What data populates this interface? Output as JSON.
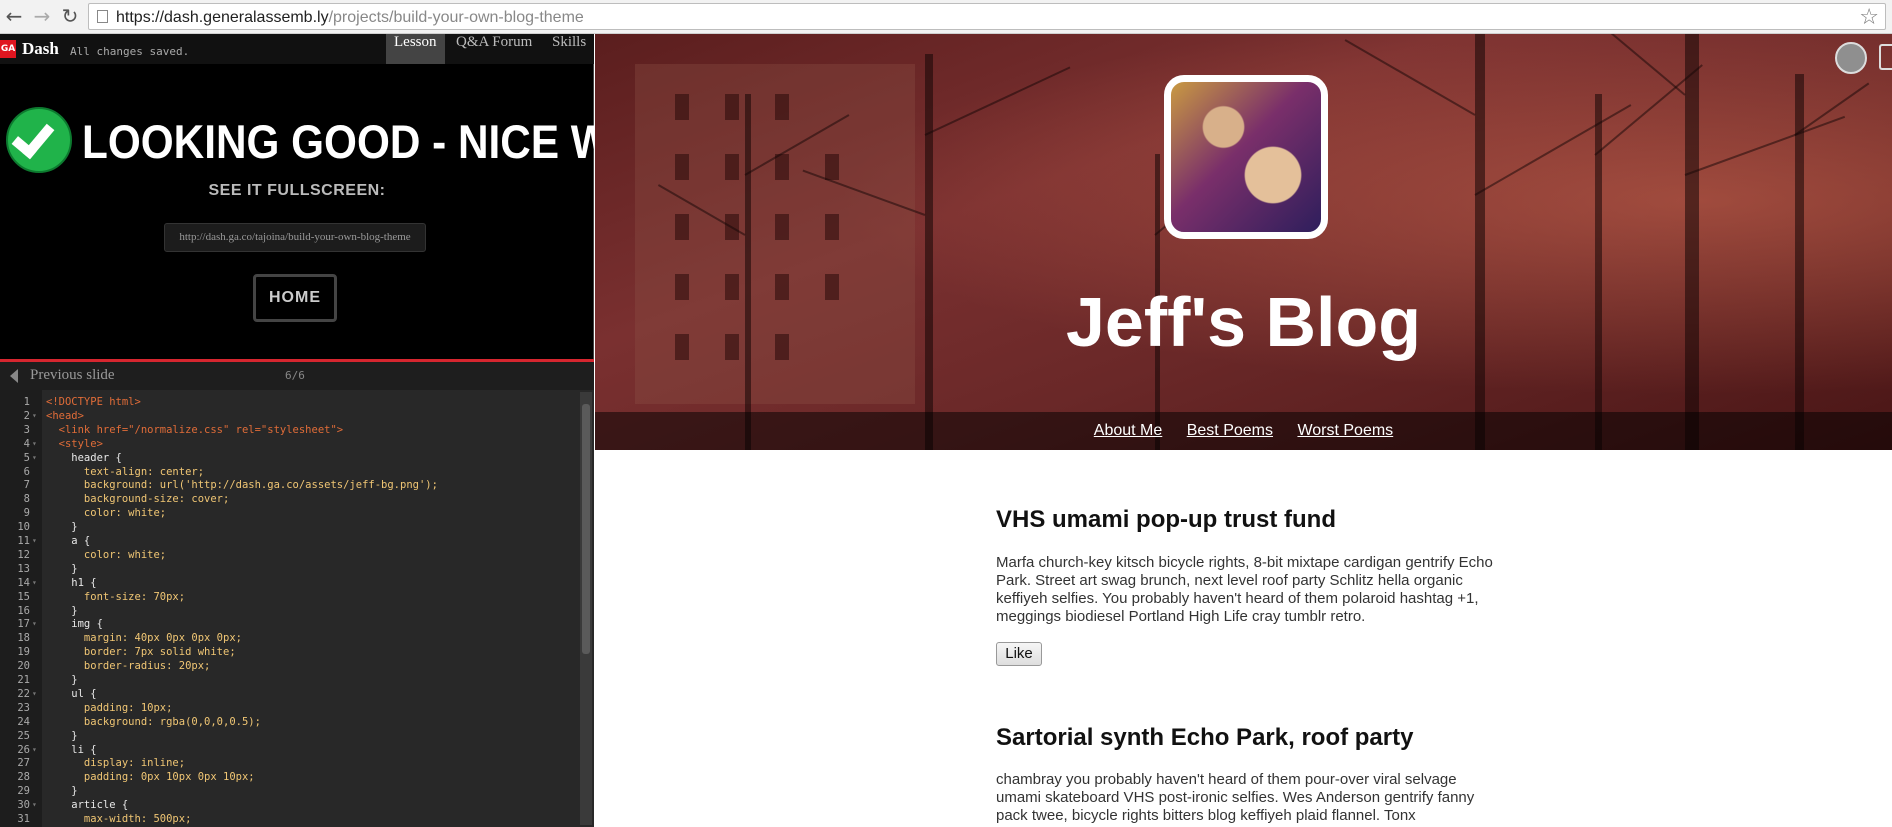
{
  "browser": {
    "url_host": "https://dash.generalassemb.ly",
    "url_path": "/projects/build-your-own-blog-theme"
  },
  "dash": {
    "logo_text": "GA",
    "app_name": "Dash",
    "status": "All changes saved.",
    "tabs": [
      {
        "label": "Lesson",
        "active": true
      },
      {
        "label": "Q&A Forum",
        "active": false
      },
      {
        "label": "Skills",
        "active": false
      }
    ],
    "success_title": "LOOKING GOOD - NICE WORK!",
    "fullscreen_label": "SEE IT FULLSCREEN:",
    "fullscreen_url": "http://dash.ga.co/tajoina/build-your-own-blog-theme",
    "home_label": "HOME",
    "prev_label": "Previous slide",
    "slide_count": "6/6",
    "accent_color": "#d6262f"
  },
  "editor": {
    "lines": [
      {
        "n": "1",
        "text": "<!DOCTYPE html>"
      },
      {
        "n": "2",
        "text": "<head>"
      },
      {
        "n": "3",
        "text": "  <link href=\"/normalize.css\" rel=\"stylesheet\">"
      },
      {
        "n": "4",
        "text": "  <style>"
      },
      {
        "n": "5",
        "text": "    header {"
      },
      {
        "n": "6",
        "text": "      text-align: center;"
      },
      {
        "n": "7",
        "text": "      background: url('http://dash.ga.co/assets/jeff-bg.png');"
      },
      {
        "n": "8",
        "text": "      background-size: cover;"
      },
      {
        "n": "9",
        "text": "      color: white;"
      },
      {
        "n": "10",
        "text": "    }"
      },
      {
        "n": "11",
        "text": "    a {"
      },
      {
        "n": "12",
        "text": "      color: white;"
      },
      {
        "n": "13",
        "text": "    }"
      },
      {
        "n": "14",
        "text": "    h1 {"
      },
      {
        "n": "15",
        "text": "      font-size: 70px;"
      },
      {
        "n": "16",
        "text": "    }"
      },
      {
        "n": "17",
        "text": "    img {"
      },
      {
        "n": "18",
        "text": "      margin: 40px 0px 0px 0px;"
      },
      {
        "n": "19",
        "text": "      border: 7px solid white;"
      },
      {
        "n": "20",
        "text": "      border-radius: 20px;"
      },
      {
        "n": "21",
        "text": "    }"
      },
      {
        "n": "22",
        "text": "    ul {"
      },
      {
        "n": "23",
        "text": "      padding: 10px;"
      },
      {
        "n": "24",
        "text": "      background: rgba(0,0,0,0.5);"
      },
      {
        "n": "25",
        "text": "    }"
      },
      {
        "n": "26",
        "text": "    li {"
      },
      {
        "n": "27",
        "text": "      display: inline;"
      },
      {
        "n": "28",
        "text": "      padding: 0px 10px 0px 10px;"
      },
      {
        "n": "29",
        "text": "    }"
      },
      {
        "n": "30",
        "text": "    article {"
      },
      {
        "n": "31",
        "text": "      max-width: 500px;"
      }
    ]
  },
  "blog": {
    "title": "Jeff's Blog",
    "nav": [
      "About Me",
      "Best Poems",
      "Worst Poems"
    ],
    "posts": [
      {
        "title": "VHS umami pop-up trust fund",
        "body": "Marfa church-key kitsch bicycle rights, 8-bit mixtape cardigan gentrify Echo Park. Street art swag brunch, next level roof party Schlitz hella organic keffiyeh selfies. You probably haven't heard of them polaroid hashtag +1, meggings biodiesel Portland High Life cray tumblr retro.",
        "like_label": "Like"
      },
      {
        "title": "Sartorial synth Echo Park, roof party",
        "body": "chambray you probably haven't heard of them pour-over viral selvage umami skateboard VHS post-ironic selfies. Wes Anderson gentrify fanny pack twee, bicycle rights bitters blog keffiyeh plaid flannel. Tonx"
      }
    ]
  }
}
